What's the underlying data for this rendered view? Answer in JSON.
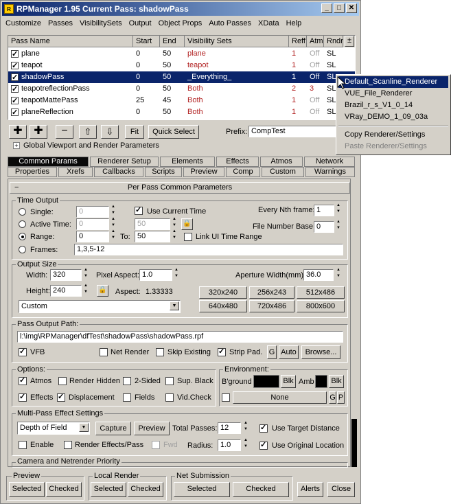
{
  "window": {
    "title": "RPManager 1.95   Current Pass: shadowPass",
    "minimize": "_",
    "maximize": "□",
    "close": "✕"
  },
  "menu": [
    "Customize",
    "Passes",
    "VisibilitySets",
    "Output",
    "Object Props",
    "Auto Passes",
    "XData",
    "Help"
  ],
  "grid": {
    "headers": {
      "name": "Pass Name",
      "start": "Start",
      "end": "End",
      "vis": "Visibility Sets",
      "reff": "Reff",
      "atm": "Atm",
      "rndr": "Rndr"
    },
    "rows": [
      {
        "name": "plane",
        "start": "0",
        "end": "50",
        "vis": "plane",
        "reff": "1",
        "atm": "Off",
        "rndr": "SL"
      },
      {
        "name": "teapot",
        "start": "0",
        "end": "50",
        "vis": "teapot",
        "reff": "1",
        "atm": "Off",
        "rndr": "SL"
      },
      {
        "name": "shadowPass",
        "start": "0",
        "end": "50",
        "vis": "_Everything_",
        "reff": "1",
        "atm": "Off",
        "rndr": "SL"
      },
      {
        "name": "teapotreflectionPass",
        "start": "0",
        "end": "50",
        "vis": "Both",
        "reff": "2",
        "atm": "3",
        "rndr": "SL"
      },
      {
        "name": "teapotMattePass",
        "start": "25",
        "end": "45",
        "vis": "Both",
        "reff": "1",
        "atm": "Off",
        "rndr": "SL"
      },
      {
        "name": "planeReflection",
        "start": "0",
        "end": "50",
        "vis": "Both",
        "reff": "1",
        "atm": "Off",
        "rndr": "SL"
      }
    ]
  },
  "toolbar": {
    "fit": "Fit",
    "quick_select": "Quick Select",
    "prefix_label": "Prefix:",
    "prefix_value": "CompTest"
  },
  "global_viewport": "Global Viewport and Render Parameters",
  "tabs_row1": [
    "Common Params",
    "Renderer Setup",
    "Elements",
    "Effects",
    "Atmos",
    "Network"
  ],
  "tabs_row2": [
    "Properties",
    "Xrefs",
    "Callbacks",
    "Scripts",
    "Preview",
    "Comp",
    "Custom",
    "Warnings"
  ],
  "rollout_title": "Per Pass Common Parameters",
  "rollout_toggle": "−",
  "time_output": {
    "label": "Time Output",
    "single": "Single:",
    "single_val": "0",
    "use_current_time": "Use Current Time",
    "every_nth": "Every Nth frame:",
    "every_nth_val": "1",
    "active_time": "Active Time:",
    "active_from": "0",
    "active_to": "50",
    "file_number_base": "File Number Base:",
    "file_number_base_val": "0",
    "range": "Range:",
    "range_from": "0",
    "to": "To:",
    "range_to": "50",
    "link_ui": "Link UI Time Range",
    "frames": "Frames:",
    "frames_val": "1,3,5-12"
  },
  "output_size": {
    "label": "Output Size",
    "width_label": "Width:",
    "width": "320",
    "pixel_aspect_label": "Pixel Aspect:",
    "pixel_aspect": "1.0",
    "aperture_label": "Aperture Width(mm):",
    "aperture": "36.0",
    "height_label": "Height:",
    "height": "240",
    "aspect_label": "Aspect:",
    "aspect": "1.33333",
    "preset": "Custom",
    "presets": [
      "320x240",
      "256x243",
      "512x486",
      "640x480",
      "720x486",
      "800x600"
    ]
  },
  "pass_output": {
    "label": "Pass Output Path:",
    "path": "l:\\img\\RPManager\\dfTest\\shadowPass\\shadowPass.rpf",
    "vfb": "VFB",
    "net_render": "Net Render",
    "skip_existing": "Skip Existing",
    "strip_pad": "Strip Pad.",
    "g": "G",
    "auto": "Auto",
    "browse": "Browse..."
  },
  "options": {
    "label": "Options:",
    "atmos": "Atmos",
    "render_hidden": "Render Hidden",
    "two_sided": "2-Sided",
    "sup_black": "Sup. Black",
    "effects": "Effects",
    "displacement": "Displacement",
    "fields": "Fields",
    "vid_check": "Vid.Check"
  },
  "environment": {
    "label": "Environment:",
    "bground": "B'ground",
    "blk": "Blk",
    "amb": "Amb",
    "none": "None",
    "g": "G",
    "p": "P"
  },
  "multipass": {
    "label": "Multi-Pass Effect Settings",
    "effect": "Depth of Field",
    "capture": "Capture",
    "preview": "Preview",
    "total_passes_label": "Total Passes:",
    "total_passes": "12",
    "use_target": "Use Target Distance",
    "enable": "Enable",
    "render_effects": "Render Effects/Pass",
    "fwd": "Fwd",
    "radius_label": "Radius:",
    "radius": "1.0",
    "use_original": "Use Original Location"
  },
  "camera_priority": "Camera and Netrender Priority",
  "bottom": {
    "preview": "Preview",
    "local_render": "Local Render",
    "net_submission": "Net Submission",
    "selected": "Selected",
    "checked": "Checked",
    "alerts": "Alerts",
    "close": "Close"
  },
  "context_menu": [
    {
      "label": "Default_Scanline_Renderer",
      "state": "highlighted"
    },
    {
      "label": "VUE_File_Renderer",
      "state": "normal"
    },
    {
      "label": "Brazil_r_s_V1_0_14",
      "state": "normal"
    },
    {
      "label": "VRay_DEMO_1_09_03a",
      "state": "normal"
    },
    {
      "label": "Copy Renderer/Settings",
      "state": "normal"
    },
    {
      "label": "Paste Renderer/Settings",
      "state": "disabled"
    }
  ],
  "colors": {
    "titlebar": "#0a246a",
    "vis_red": "#b22222",
    "selection": "#0a246a",
    "face": "#d4d0c8"
  }
}
